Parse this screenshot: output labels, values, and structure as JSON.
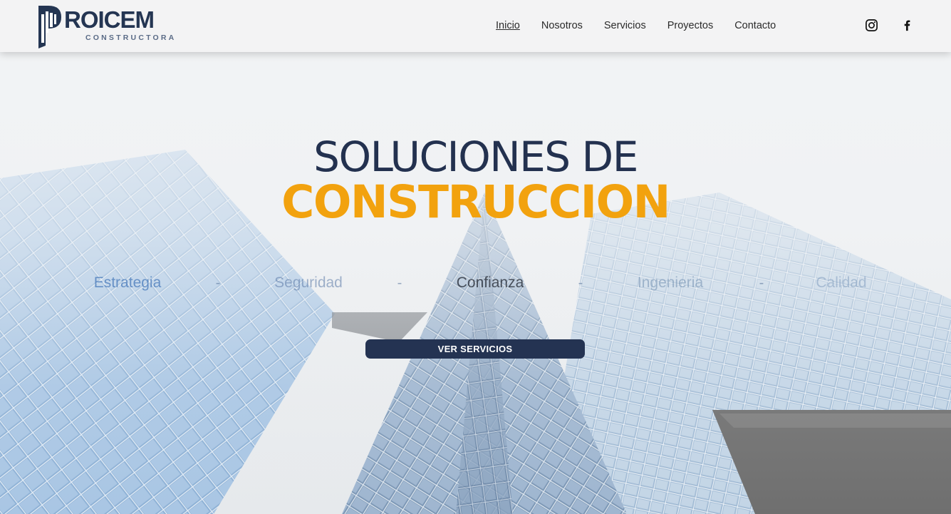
{
  "brand": {
    "wordmark": "ROICEM",
    "tagline": "CONSTRUCTORA",
    "primary_color": "#243552",
    "accent_color": "#f2a20e"
  },
  "nav": {
    "items": [
      {
        "label": "Inicio",
        "active": true
      },
      {
        "label": "Nosotros",
        "active": false
      },
      {
        "label": "Servicios",
        "active": false
      },
      {
        "label": "Proyectos",
        "active": false
      },
      {
        "label": "Contacto",
        "active": false
      }
    ]
  },
  "social": {
    "icons": [
      "instagram-icon",
      "facebook-icon"
    ]
  },
  "hero": {
    "title": "SOLUCIONES DE",
    "subtitle": "CONSTRUCCION",
    "values": [
      "Estrategia",
      "Seguridad",
      "Confianza",
      "Ingenieria",
      "Calidad"
    ],
    "separator": "-",
    "cta_label": "VER SERVICIOS"
  }
}
